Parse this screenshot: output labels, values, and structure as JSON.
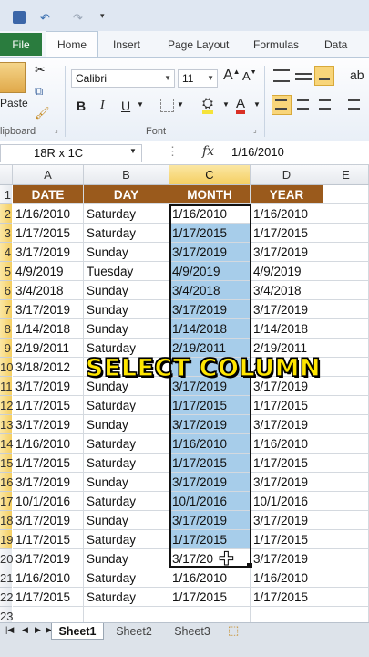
{
  "ribbon_tabs": {
    "file": "File",
    "home": "Home",
    "insert": "Insert",
    "page_layout": "Page Layout",
    "formulas": "Formulas",
    "data": "Data"
  },
  "ribbon": {
    "paste": "Paste",
    "clipboard_group": "lipboard",
    "font_name": "Calibri",
    "font_size": "11",
    "font_group": "Font",
    "bold": "B",
    "italic": "I",
    "underline": "U",
    "grow_font": "A",
    "shrink_font": "A",
    "font_color": "A"
  },
  "formula_bar": {
    "name_box": "18R x 1C",
    "fx": "fx",
    "value": "1/16/2010"
  },
  "columns": [
    "A",
    "B",
    "C",
    "D",
    "E"
  ],
  "headers": {
    "date": "DATE",
    "day": "DAY",
    "month": "MONTH",
    "year": "YEAR"
  },
  "row_numbers": [
    "1",
    "2",
    "3",
    "4",
    "5",
    "6",
    "7",
    "8",
    "9",
    "10",
    "11",
    "12",
    "13",
    "14",
    "15",
    "16",
    "17",
    "18",
    "19",
    "20",
    "21",
    "22",
    "23"
  ],
  "rows": [
    [
      "1/16/2010",
      "Saturday",
      "1/16/2010",
      "1/16/2010"
    ],
    [
      "1/17/2015",
      "Saturday",
      "1/17/2015",
      "1/17/2015"
    ],
    [
      "3/17/2019",
      "Sunday",
      "3/17/2019",
      "3/17/2019"
    ],
    [
      "4/9/2019",
      "Tuesday",
      "4/9/2019",
      "4/9/2019"
    ],
    [
      "3/4/2018",
      "Sunday",
      "3/4/2018",
      "3/4/2018"
    ],
    [
      "3/17/2019",
      "Sunday",
      "3/17/2019",
      "3/17/2019"
    ],
    [
      "1/14/2018",
      "Sunday",
      "1/14/2018",
      "1/14/2018"
    ],
    [
      "2/19/2011",
      "Saturday",
      "2/19/2011",
      "2/19/2011"
    ],
    [
      "3/18/2012",
      "",
      "",
      "2"
    ],
    [
      "3/17/2019",
      "Sunday",
      "3/17/2019",
      "3/17/2019"
    ],
    [
      "1/17/2015",
      "Saturday",
      "1/17/2015",
      "1/17/2015"
    ],
    [
      "3/17/2019",
      "Sunday",
      "3/17/2019",
      "3/17/2019"
    ],
    [
      "1/16/2010",
      "Saturday",
      "1/16/2010",
      "1/16/2010"
    ],
    [
      "1/17/2015",
      "Saturday",
      "1/17/2015",
      "1/17/2015"
    ],
    [
      "3/17/2019",
      "Sunday",
      "3/17/2019",
      "3/17/2019"
    ],
    [
      "10/1/2016",
      "Saturday",
      "10/1/2016",
      "10/1/2016"
    ],
    [
      "3/17/2019",
      "Sunday",
      "3/17/2019",
      "3/17/2019"
    ],
    [
      "1/17/2015",
      "Saturday",
      "1/17/2015",
      "1/17/2015"
    ],
    [
      "3/17/2019",
      "Sunday",
      "3/17/20",
      "3/17/2019"
    ],
    [
      "1/16/2010",
      "Saturday",
      "1/16/2010",
      "1/16/2010"
    ],
    [
      "1/17/2015",
      "Saturday",
      "1/17/2015",
      "1/17/2015"
    ]
  ],
  "overlay_text": "SELECT COLUMN",
  "sheet_tabs": [
    "Sheet1",
    "Sheet2",
    "Sheet3"
  ],
  "colors": {
    "header_fill": "#9a5a1c",
    "selection_fill": "#a7cdea",
    "overlay_text": "#ffe600",
    "file_tab": "#2a7c3e"
  }
}
